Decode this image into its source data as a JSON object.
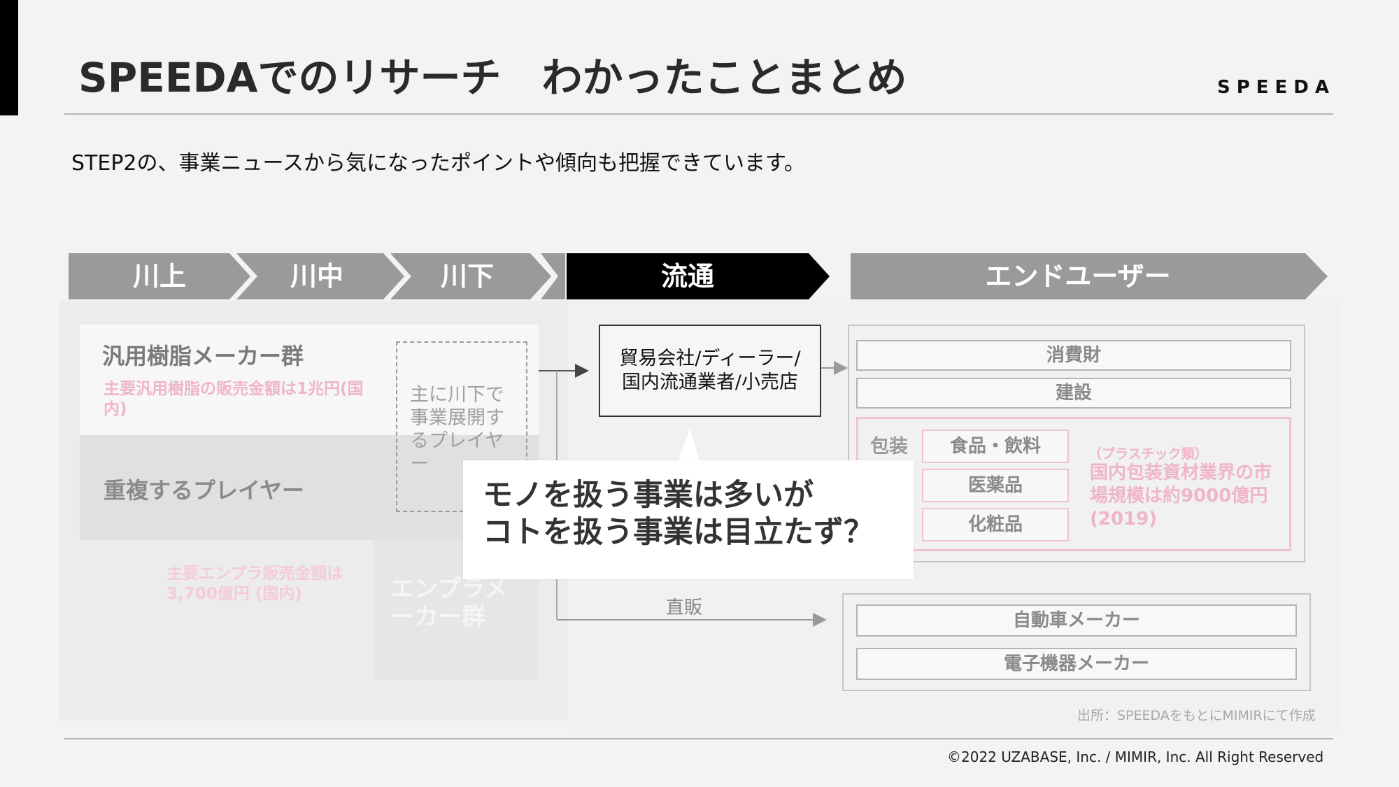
{
  "header": {
    "title": "SPEEDAでのリサーチ　わかったことまとめ",
    "brand": "SPEEDA"
  },
  "subtitle": "STEP2の、事業ニュースから気になったポイントや傾向も把握できています。",
  "stages": [
    "川上",
    "川中",
    "川下",
    "流通",
    "エンドユーザー"
  ],
  "left": {
    "resin_title": "汎用樹脂メーカー群",
    "resin_note": "主要汎用樹脂の販売金額は1兆円(国内)",
    "duplicate": "重複するプレイヤー",
    "engpla_note": "主要エンプラ販売金額は3,700億円 (国内)",
    "engpla_title": "エンプラメーカー群",
    "dashed_text": "主に川下で事業展開するプレイヤー"
  },
  "dealer": {
    "line1": "貿易会社/ディーラー/",
    "line2": "国内流通業者/小売店"
  },
  "callout": {
    "line1": "モノを扱う事業は多いが",
    "line2": "コトを扱う事業は目立たず？"
  },
  "end_users": {
    "consumer": "消費財",
    "construction": "建設",
    "packaging": "包装",
    "pack_items": [
      "食品・飲料",
      "医薬品",
      "化粧品"
    ],
    "plastic_label": "（プラスチック類）",
    "market_note": "国内包装資材業界の市場規模は約9000億円(2019)",
    "direct": "直販",
    "auto": "自動車メーカー",
    "electronics": "電子機器メーカー"
  },
  "footer": {
    "source": "出所：SPEEDAをもとにMIMIRにて作成",
    "copyright": "©2022 UZABASE, Inc. / MIMIR, Inc. All Right Reserved"
  },
  "colors": {
    "chevron_gray": "#9a9a9a",
    "chevron_active": "#000000",
    "pink": "#f0b5c8"
  }
}
